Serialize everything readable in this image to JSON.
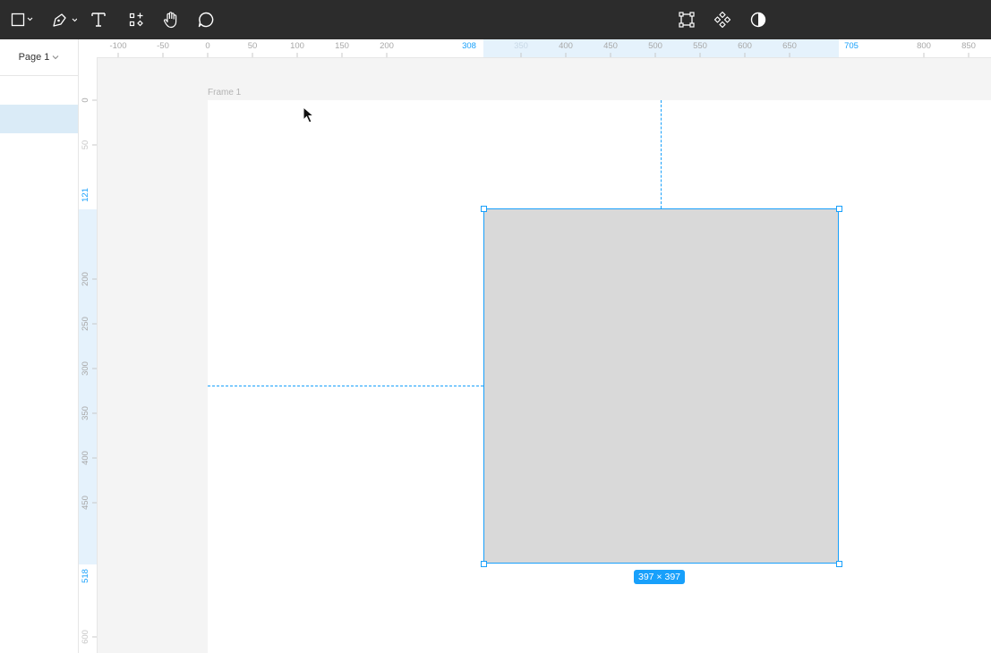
{
  "app": {
    "name": "Figma-like design editor"
  },
  "toolbar": {
    "left_tools": [
      {
        "name": "frame-rectangle-tool",
        "icon": "rectangle-icon",
        "has_dropdown": true
      },
      {
        "name": "pen-tool",
        "icon": "pen-icon",
        "has_dropdown": true
      },
      {
        "name": "text-tool",
        "icon": "text-icon"
      },
      {
        "name": "resources-tool",
        "icon": "components-grid-icon"
      },
      {
        "name": "hand-tool",
        "icon": "hand-icon"
      },
      {
        "name": "comment-tool",
        "icon": "comment-icon"
      }
    ],
    "center_tools": [
      {
        "name": "edit-object-button",
        "icon": "bounding-box-icon"
      },
      {
        "name": "create-component-button",
        "icon": "component-icon"
      },
      {
        "name": "mask-button",
        "icon": "contrast-icon"
      }
    ]
  },
  "sidebar": {
    "page_selector": "Page 1"
  },
  "rulers": {
    "horizontal_ticks": [
      "-100",
      "-50",
      "0",
      "50",
      "100",
      "150",
      "200",
      "350",
      "400",
      "450",
      "500",
      "550",
      "600",
      "650",
      "800",
      "850"
    ],
    "horizontal_marks": [
      "308",
      "705"
    ],
    "vertical_ticks": [
      "0",
      "50",
      "200",
      "250",
      "300",
      "350",
      "400",
      "450",
      "600"
    ],
    "vertical_marks": [
      "121",
      "518"
    ]
  },
  "canvas": {
    "frame_label": "Frame 1",
    "selection_size": "397 × 397"
  },
  "colors": {
    "toolbar_bg": "#2c2c2c",
    "selection": "#18a0fb",
    "shape_fill": "#d9d9d9",
    "canvas_bg": "#f4f4f4"
  }
}
